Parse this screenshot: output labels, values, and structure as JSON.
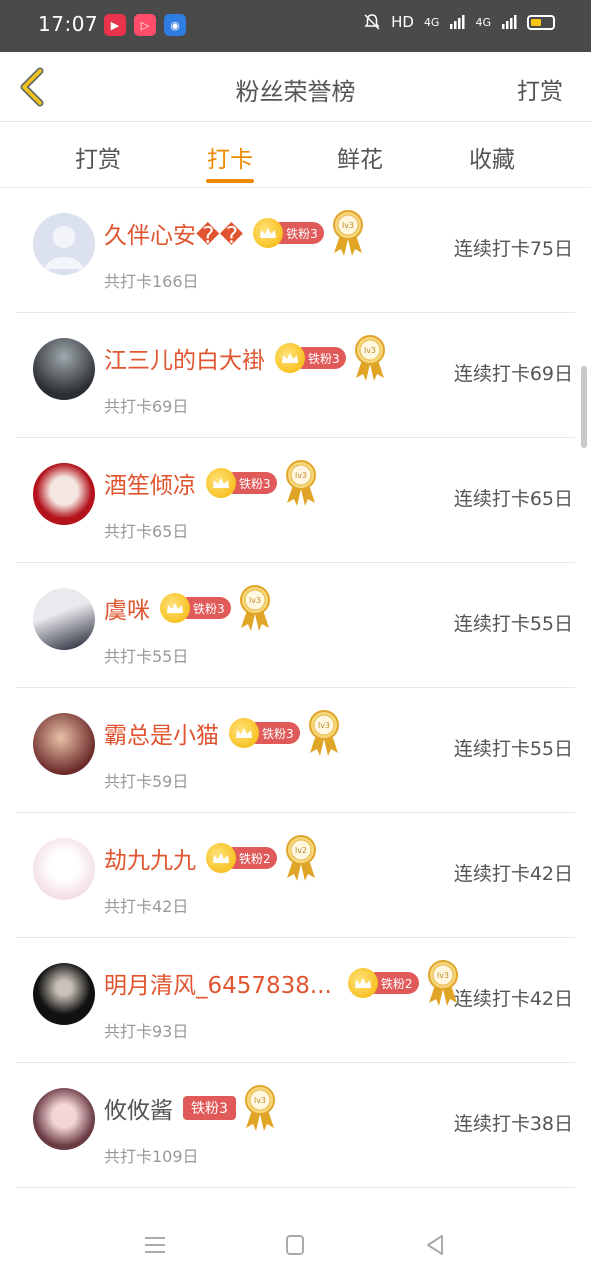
{
  "status_bar": {
    "time": "17:07",
    "network_label": "HD",
    "signal1": "4G",
    "signal2": "4G"
  },
  "header": {
    "title": "粉丝荣誉榜",
    "action": "打赏"
  },
  "tabs": [
    "打赏",
    "打卡",
    "鲜花",
    "收藏"
  ],
  "active_tab": "打卡",
  "colors": {
    "accent": "#ef8a00",
    "name_red": "#e05530",
    "badge_red": "#e05a5a",
    "crown_gold": "#f5b400"
  },
  "fans": [
    {
      "name": "久伴心安��",
      "badge": "铁粉3",
      "level": "lv3",
      "total": "共打卡166日",
      "streak": "连续打卡75日"
    },
    {
      "name": "江三儿的白大褂",
      "badge": "铁粉3",
      "level": "lv3",
      "total": "共打卡69日",
      "streak": "连续打卡69日"
    },
    {
      "name": "酒笙倾凉",
      "badge": "铁粉3",
      "level": "lv3",
      "total": "共打卡65日",
      "streak": "连续打卡65日"
    },
    {
      "name": "虞咪",
      "badge": "铁粉3",
      "level": "lv3",
      "total": "共打卡55日",
      "streak": "连续打卡55日"
    },
    {
      "name": "霸总是小猫",
      "badge": "铁粉3",
      "level": "lv3",
      "total": "共打卡59日",
      "streak": "连续打卡55日"
    },
    {
      "name": "劫九九九",
      "badge": "铁粉2",
      "level": "lv2",
      "total": "共打卡42日",
      "streak": "连续打卡42日"
    },
    {
      "name": "明月清风_6457838...",
      "badge": "铁粉2",
      "level": "lv3",
      "total": "共打卡93日",
      "streak": "连续打卡42日"
    },
    {
      "name": "攸攸酱",
      "badge": "铁粉3",
      "level": "lv3",
      "total": "共打卡109日",
      "streak": "连续打卡38日"
    }
  ]
}
